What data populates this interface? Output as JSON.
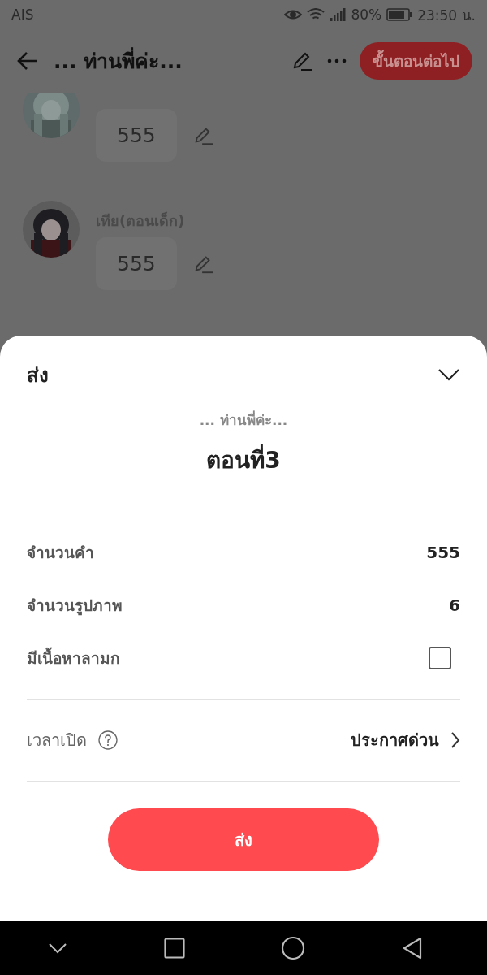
{
  "status_bar": {
    "carrier": "AIS",
    "battery": "80%",
    "time": "23:50 น."
  },
  "header": {
    "title": "... ท่านพี่ค่ะ...",
    "next_button": "ขั้นตอนต่อไป"
  },
  "messages": [
    {
      "text": "555"
    },
    {
      "name": "เทีย(ตอนเด็ก)",
      "text": "555"
    }
  ],
  "sheet": {
    "title": "ส่ง",
    "subtitle": "... ท่านพี่ค่ะ...",
    "episode": "ตอนที่3",
    "stats": [
      {
        "kind": "value",
        "label": "จำนวนคำ",
        "value": "555"
      },
      {
        "kind": "value",
        "label": "จำนวนรูปภาพ",
        "value": "6"
      },
      {
        "kind": "checkbox",
        "label": "มีเนื้อหาลามก",
        "checked": false
      }
    ],
    "open_time": {
      "label": "เวลาเปิด",
      "value": "ประกาศด่วน"
    },
    "submit_button": "ส่ง"
  }
}
